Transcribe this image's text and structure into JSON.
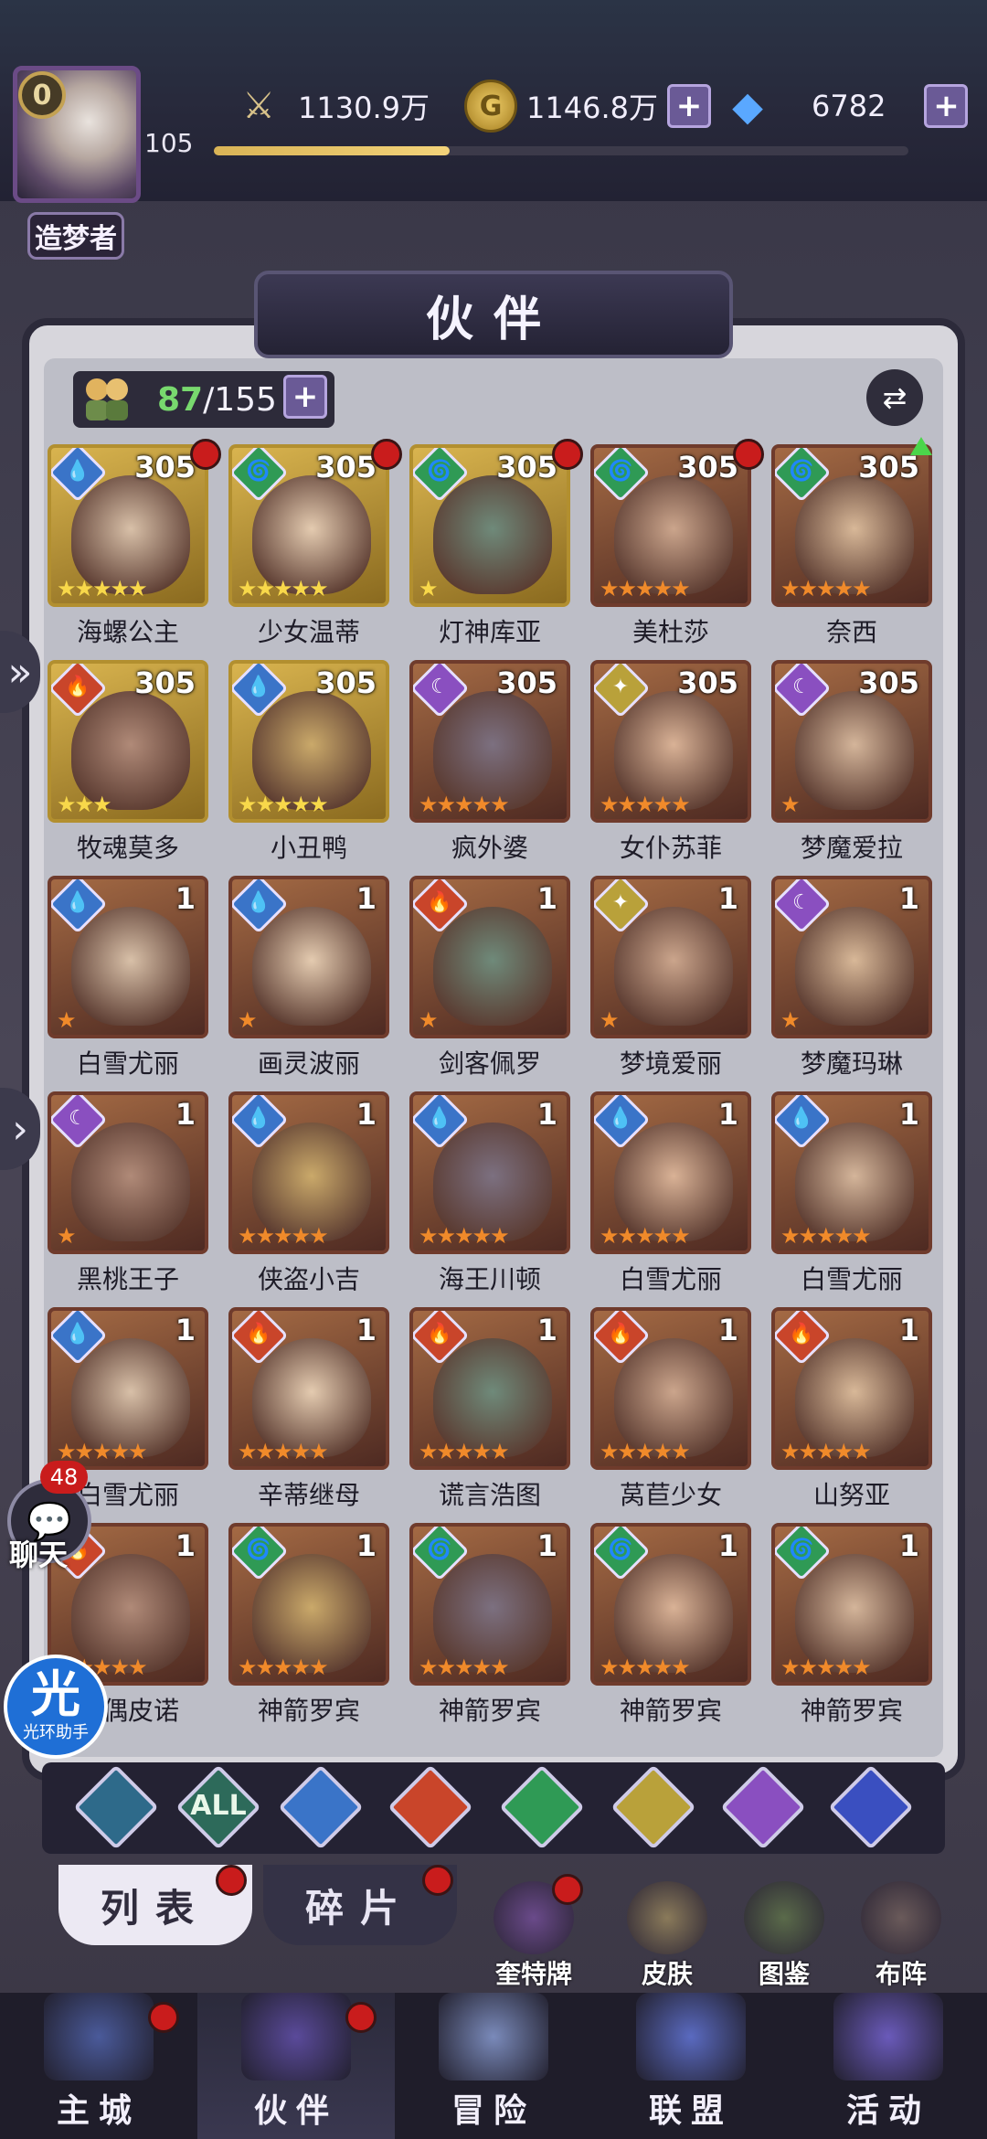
{
  "player": {
    "vip_level": "0",
    "level": "105",
    "title": "造梦者"
  },
  "resources": {
    "power": "1130.9万",
    "gold": "1146.8万",
    "gems": "6782",
    "plus": "+"
  },
  "page_title": "伙伴",
  "roster": {
    "owned": "87",
    "capacity": "/155"
  },
  "heroes": [
    {
      "name": "海螺公主",
      "level": "305",
      "element": "water",
      "stars": 5,
      "frame": "gold",
      "red_dot": true
    },
    {
      "name": "少女温蒂",
      "level": "305",
      "element": "wind",
      "stars": 5,
      "frame": "gold",
      "red_dot": true
    },
    {
      "name": "灯神库亚",
      "level": "305",
      "element": "wind",
      "stars": 1,
      "frame": "gold",
      "red_dot": true
    },
    {
      "name": "美杜莎",
      "level": "305",
      "element": "wind",
      "stars": 5,
      "frame": "bronze",
      "red_dot": true
    },
    {
      "name": "奈西",
      "level": "305",
      "element": "wind",
      "stars": 5,
      "frame": "bronze",
      "up_arrow": true
    },
    {
      "name": "牧魂莫多",
      "level": "305",
      "element": "fire",
      "stars": 3,
      "frame": "gold"
    },
    {
      "name": "小丑鸭",
      "level": "305",
      "element": "water",
      "stars": 5,
      "frame": "gold"
    },
    {
      "name": "疯外婆",
      "level": "305",
      "element": "dark",
      "stars": 5,
      "frame": "bronze"
    },
    {
      "name": "女仆苏菲",
      "level": "305",
      "element": "light",
      "stars": 5,
      "frame": "bronze"
    },
    {
      "name": "梦魔爱拉",
      "level": "305",
      "element": "dark",
      "stars": 1,
      "frame": "bronze"
    },
    {
      "name": "白雪尤丽",
      "level": "1",
      "element": "water",
      "stars": 1,
      "frame": "bronze"
    },
    {
      "name": "画灵波丽",
      "level": "1",
      "element": "water",
      "stars": 1,
      "frame": "bronze"
    },
    {
      "name": "剑客佩罗",
      "level": "1",
      "element": "fire",
      "stars": 1,
      "frame": "bronze"
    },
    {
      "name": "梦境爱丽",
      "level": "1",
      "element": "light",
      "stars": 1,
      "frame": "bronze"
    },
    {
      "name": "梦魔玛琳",
      "level": "1",
      "element": "dark",
      "stars": 1,
      "frame": "bronze"
    },
    {
      "name": "黑桃王子",
      "level": "1",
      "element": "dark",
      "stars": 1,
      "frame": "bronze"
    },
    {
      "name": "侠盗小吉",
      "level": "1",
      "element": "water",
      "stars": 5,
      "frame": "bronze"
    },
    {
      "name": "海王川顿",
      "level": "1",
      "element": "water",
      "stars": 5,
      "frame": "bronze"
    },
    {
      "name": "白雪尤丽",
      "level": "1",
      "element": "water",
      "stars": 5,
      "frame": "bronze"
    },
    {
      "name": "白雪尤丽",
      "level": "1",
      "element": "water",
      "stars": 5,
      "frame": "bronze"
    },
    {
      "name": "白雪尤丽",
      "level": "1",
      "element": "water",
      "stars": 5,
      "frame": "bronze"
    },
    {
      "name": "辛蒂继母",
      "level": "1",
      "element": "fire",
      "stars": 5,
      "frame": "bronze"
    },
    {
      "name": "谎言浩图",
      "level": "1",
      "element": "fire",
      "stars": 5,
      "frame": "bronze"
    },
    {
      "name": "莴苣少女",
      "level": "1",
      "element": "fire",
      "stars": 5,
      "frame": "bronze"
    },
    {
      "name": "山努亚",
      "level": "1",
      "element": "fire",
      "stars": 5,
      "frame": "bronze"
    },
    {
      "name": "木偶皮诺",
      "level": "1",
      "element": "fire",
      "stars": 5,
      "frame": "bronze"
    },
    {
      "name": "神箭罗宾",
      "level": "1",
      "element": "wind",
      "stars": 5,
      "frame": "bronze"
    },
    {
      "name": "神箭罗宾",
      "level": "1",
      "element": "wind",
      "stars": 5,
      "frame": "bronze"
    },
    {
      "name": "神箭罗宾",
      "level": "1",
      "element": "wind",
      "stars": 5,
      "frame": "bronze"
    },
    {
      "name": "神箭罗宾",
      "level": "1",
      "element": "wind",
      "stars": 5,
      "frame": "bronze"
    }
  ],
  "element_colors": {
    "water": "#3a74c8",
    "wind": "#2f9a55",
    "fire": "#c9452a",
    "light": "#b9a13a",
    "dark": "#8a4fc0",
    "cosmic": "#3a4fc0",
    "all": "#2d6a5a",
    "neutral": "#2e6a8a"
  },
  "element_glyphs": {
    "water": "💧",
    "wind": "🌀",
    "fire": "🔥",
    "light": "✦",
    "dark": "☾"
  },
  "filters": [
    {
      "id": "neutral",
      "label": ""
    },
    {
      "id": "all",
      "label": "ALL"
    },
    {
      "id": "water",
      "label": ""
    },
    {
      "id": "fire",
      "label": ""
    },
    {
      "id": "wind",
      "label": ""
    },
    {
      "id": "light",
      "label": ""
    },
    {
      "id": "dark",
      "label": ""
    },
    {
      "id": "cosmic",
      "label": ""
    }
  ],
  "tabs": {
    "list": "列表",
    "fragments": "碎片"
  },
  "shortcuts": [
    {
      "label": "奎特牌",
      "icon": "tarot-deck-icon"
    },
    {
      "label": "皮肤",
      "icon": "skin-icon"
    },
    {
      "label": "图鉴",
      "icon": "codex-icon"
    },
    {
      "label": "布阵",
      "icon": "formation-icon"
    }
  ],
  "nav": [
    {
      "label": "主城",
      "icon": "castle-icon",
      "active": false,
      "red_dot": true
    },
    {
      "label": "伙伴",
      "icon": "partner-hat-icon",
      "active": true,
      "red_dot": true
    },
    {
      "label": "冒险",
      "icon": "compass-icon",
      "active": false
    },
    {
      "label": "联盟",
      "icon": "alliance-shield-icon",
      "active": false
    },
    {
      "label": "活动",
      "icon": "cards-icon",
      "active": false
    }
  ],
  "chat": {
    "unread": "48",
    "label": "聊天"
  },
  "helper": {
    "glyph": "光",
    "label": "光环助手"
  },
  "level_progress": 0.34
}
